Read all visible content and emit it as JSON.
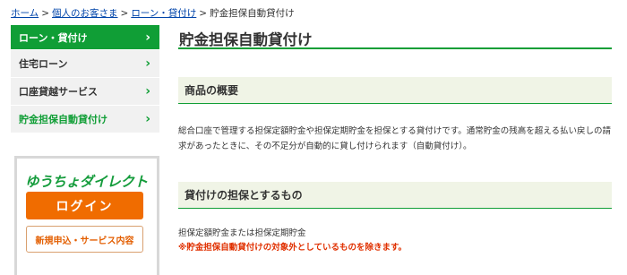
{
  "breadcrumb": {
    "items": [
      "ホーム",
      "個人のお客さま",
      "ローン・貸付け"
    ],
    "current": "貯金担保自動貸付け",
    "separator": ">"
  },
  "sidebar": {
    "items": [
      {
        "label": "ローン・貸付け",
        "state": "header"
      },
      {
        "label": "住宅ローン",
        "state": "normal"
      },
      {
        "label": "口座貸越サービス",
        "state": "normal"
      },
      {
        "label": "貯金担保自動貸付け",
        "state": "current"
      }
    ],
    "chevron": "›"
  },
  "promo": {
    "logo_text": "ゆうちょダイレクト",
    "login_label": "ログイン",
    "signup_label": "新規申込・サービス内容"
  },
  "main": {
    "title": "貯金担保自動貸付け",
    "sections": [
      {
        "heading": "商品の概要",
        "body": "総合口座で管理する担保定額貯金や担保定期貯金を担保とする貸付けです。通常貯金の残高を超える払い戻しの請求があったときに、その不足分が自動的に貸し付けられます（自動貸付け）。"
      },
      {
        "heading": "貸付けの担保とするもの",
        "body": "担保定額貯金または担保定期貯金",
        "note": "※貯金担保自動貸付けの対象外としているものを除きます。"
      }
    ]
  },
  "colors": {
    "brand_green": "#109e36",
    "accent_orange": "#f06c00",
    "link_blue": "#0044aa",
    "note_red": "#e03000"
  }
}
